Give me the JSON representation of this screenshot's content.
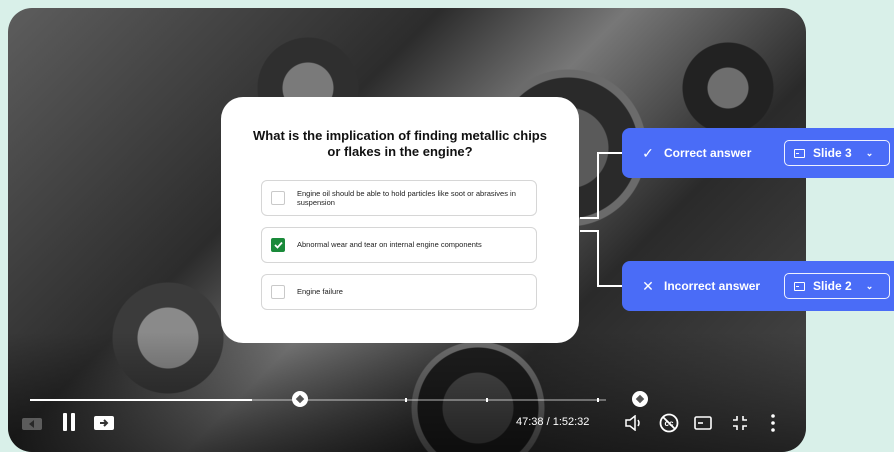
{
  "quiz": {
    "question": "What is the implication of finding metallic chips or flakes in the engine?",
    "options": [
      {
        "text": "Engine oil should be able to hold particles like soot or abrasives in suspension",
        "checked": false
      },
      {
        "text": "Abnormal wear and tear on internal engine components",
        "checked": true
      },
      {
        "text": "Engine failure",
        "checked": false
      }
    ]
  },
  "branches": {
    "correct": {
      "label": "Correct answer",
      "icon": "checkmark-icon",
      "target": "Slide 3"
    },
    "incorrect": {
      "label": "Incorrect answer",
      "icon": "x-icon",
      "target": "Slide 2"
    }
  },
  "player": {
    "time": "47:38 / 1:52:32",
    "progress": 0.39
  },
  "colors": {
    "accent": "#4a6cf7",
    "check": "#1a8a3a",
    "page_bg": "#d9f0e9"
  }
}
